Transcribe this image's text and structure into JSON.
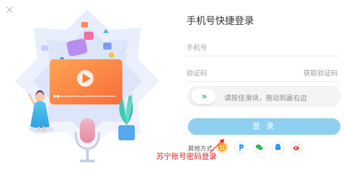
{
  "login": {
    "title": "手机号快捷登录",
    "phone_placeholder": "手机号",
    "code_placeholder": "验证码",
    "get_code_label": "获取验证码",
    "slider_hint": "请按住滑块，拖动到最右边",
    "slider_glyph": "»",
    "submit_label": "登 录",
    "other_methods_label": "其他方式:"
  },
  "social": [
    {
      "name": "suning-icon",
      "color": "#f5a623"
    },
    {
      "name": "pay-icon",
      "color": "#1a8ee8"
    },
    {
      "name": "wechat-icon",
      "color": "#2dbb4f"
    },
    {
      "name": "qq-icon",
      "color": "#2e9bf0"
    },
    {
      "name": "weibo-icon",
      "color": "#e8423a"
    }
  ],
  "annotation": {
    "text": "苏宁账号密码登录"
  },
  "colors": {
    "accent": "#8fd0f0",
    "slider_arrow": "#3ebd6a",
    "annotation": "#e02020",
    "video_card": "#fb8a45"
  }
}
